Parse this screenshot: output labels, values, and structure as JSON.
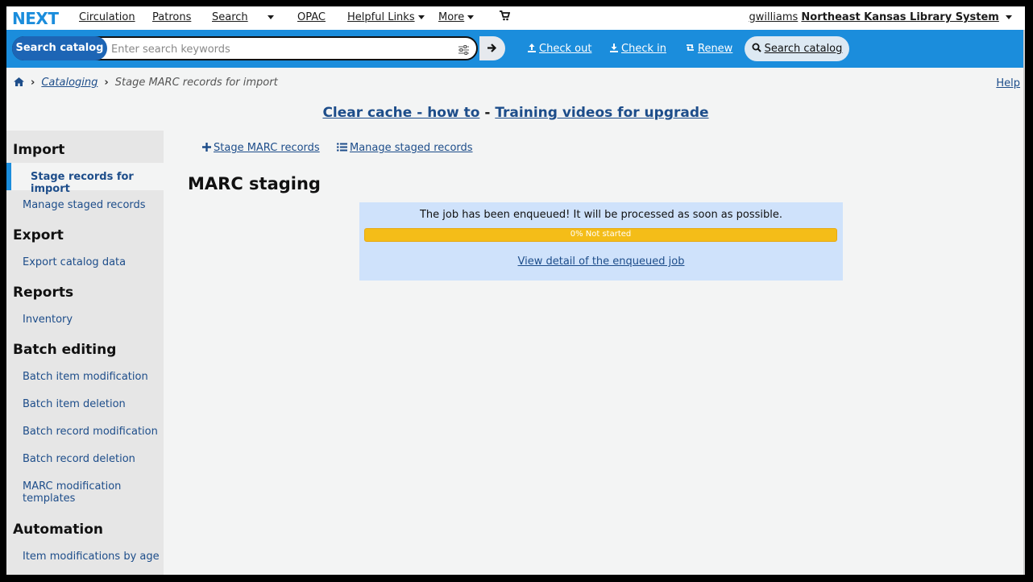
{
  "topnav": {
    "logo": "NEXT",
    "items": [
      "Circulation",
      "Patrons",
      "Search",
      "OPAC",
      "Helpful Links",
      "More"
    ],
    "user": "gwilliams",
    "library": "Northeast Kansas Library System"
  },
  "searchbar": {
    "label": "Search catalog",
    "placeholder": "Enter search keywords",
    "checkout": "Check out",
    "checkin": "Check in",
    "renew": "Renew",
    "search_button": "Search catalog"
  },
  "breadcrumb": {
    "cataloging": "Cataloging",
    "current": "Stage MARC records for import",
    "help": "Help"
  },
  "banner": {
    "link1": "Clear cache - how to",
    "separator": " - ",
    "link2": "Training videos for upgrade"
  },
  "sidebar": {
    "import_heading": "Import",
    "import_items": [
      "Stage records for import",
      "Manage staged records"
    ],
    "export_heading": "Export",
    "export_items": [
      "Export catalog data"
    ],
    "reports_heading": "Reports",
    "reports_items": [
      "Inventory"
    ],
    "batch_heading": "Batch editing",
    "batch_items": [
      "Batch item modification",
      "Batch item deletion",
      "Batch record modification",
      "Batch record deletion",
      "MARC modification",
      "templates"
    ],
    "automation_heading": "Automation",
    "automation_items": [
      "Item modifications by age"
    ]
  },
  "toolbar": {
    "stage": "Stage MARC records",
    "manage": "Manage staged records"
  },
  "main": {
    "title": "MARC staging",
    "message": "The job has been enqueued! It will be processed as soon as possible.",
    "progress_percent": 0,
    "progress_label": "0% Not started",
    "detail_link": "View detail of the enqueued job"
  },
  "colors": {
    "accent": "#1b8ddc",
    "alert_bg": "#cfe2fb",
    "progress": "#f4bd18"
  }
}
